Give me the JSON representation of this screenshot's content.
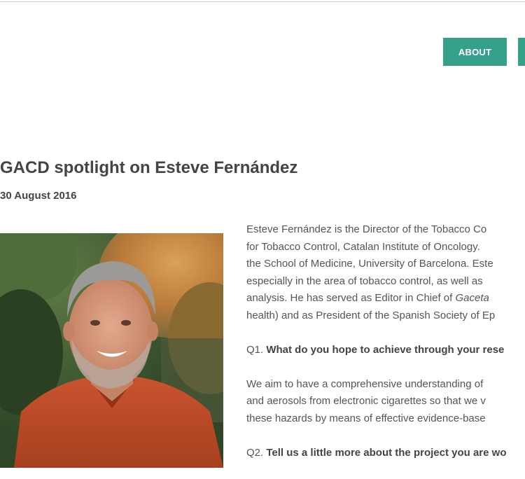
{
  "nav": {
    "about_label": "About"
  },
  "article": {
    "title": "GACD spotlight on Esteve Fernández",
    "date": "30 August 2016",
    "photo_alt": "Portrait of Esteve Fernández",
    "intro_lines": [
      "Esteve Fernández is the Director of the Tobacco Co",
      "for Tobacco Control, Catalan Institute of Oncology.",
      "the School of Medicine, University of Barcelona. Este",
      "especially in the area of tobacco control, as well as",
      "analysis. He has served as Editor in Chief of ",
      "health) and as President of the Spanish Society of Ep"
    ],
    "intro_italic": "Gaceta",
    "q1_prefix": "Q1. ",
    "q1_text": "What do you hope to achieve through your rese",
    "a1_lines": [
      "We aim to have a comprehensive understanding of",
      "and aerosols from electronic cigarettes so that we v",
      "these hazards by means of effective evidence-base"
    ],
    "q2_prefix": "Q2. ",
    "q2_text": "Tell us a little more about the project you are wo"
  }
}
